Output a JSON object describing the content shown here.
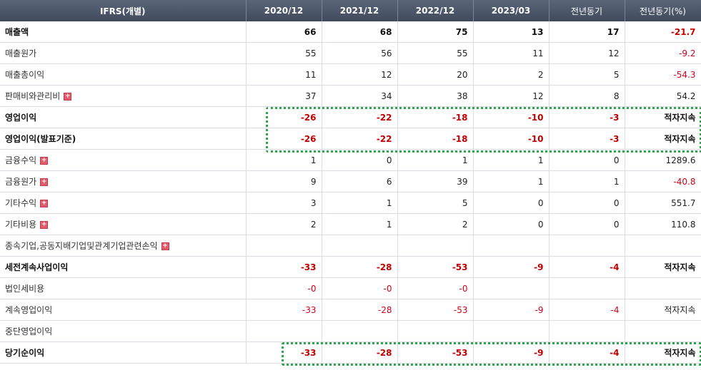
{
  "header": {
    "label": "IFRS(개별)",
    "periods": [
      "2020/12",
      "2021/12",
      "2022/12",
      "2023/03",
      "전년동기",
      "전년동기(%)"
    ]
  },
  "rows": [
    {
      "label": "매출액",
      "values": [
        "66",
        "68",
        "75",
        "13",
        "17",
        "-21.7"
      ],
      "bold": true,
      "expand": false,
      "sep": false
    },
    {
      "label": "매출원가",
      "values": [
        "55",
        "56",
        "55",
        "11",
        "12",
        "-9.2"
      ],
      "bold": false,
      "expand": false,
      "sep": false
    },
    {
      "label": "매출총이익",
      "values": [
        "11",
        "12",
        "20",
        "2",
        "5",
        "-54.3"
      ],
      "bold": false,
      "expand": false,
      "sep": false
    },
    {
      "label": "판매비와관리비",
      "values": [
        "37",
        "34",
        "38",
        "12",
        "8",
        "54.2"
      ],
      "bold": false,
      "expand": true,
      "sep": false
    },
    {
      "label": "영업이익",
      "values": [
        "-26",
        "-22",
        "-18",
        "-10",
        "-3",
        "적자지속"
      ],
      "bold": true,
      "expand": false,
      "sep": true
    },
    {
      "label": "영업이익(발표기준)",
      "values": [
        "-26",
        "-22",
        "-18",
        "-10",
        "-3",
        "적자지속"
      ],
      "bold": true,
      "expand": false,
      "sep": false
    },
    {
      "label": "금융수익",
      "values": [
        "1",
        "0",
        "1",
        "1",
        "0",
        "1289.6"
      ],
      "bold": false,
      "expand": true,
      "sep": false
    },
    {
      "label": "금융원가",
      "values": [
        "9",
        "6",
        "39",
        "1",
        "1",
        "-40.8"
      ],
      "bold": false,
      "expand": true,
      "sep": false
    },
    {
      "label": "기타수익",
      "values": [
        "3",
        "1",
        "5",
        "0",
        "0",
        "551.7"
      ],
      "bold": false,
      "expand": true,
      "sep": false
    },
    {
      "label": "기타비용",
      "values": [
        "2",
        "1",
        "2",
        "0",
        "0",
        "110.8"
      ],
      "bold": false,
      "expand": true,
      "sep": false
    },
    {
      "label": "종속기업,공동지배기업및관계기업관련손익",
      "values": [
        "",
        "",
        "",
        "",
        "",
        ""
      ],
      "bold": false,
      "expand": true,
      "sep": false
    },
    {
      "label": "세전계속사업이익",
      "values": [
        "-33",
        "-28",
        "-53",
        "-9",
        "-4",
        "적자지속"
      ],
      "bold": true,
      "expand": false,
      "sep": true
    },
    {
      "label": "법인세비용",
      "values": [
        "-0",
        "-0",
        "-0",
        "",
        "",
        ""
      ],
      "bold": false,
      "expand": false,
      "sep": false
    },
    {
      "label": "계속영업이익",
      "values": [
        "-33",
        "-28",
        "-53",
        "-9",
        "-4",
        "적자지속"
      ],
      "bold": false,
      "expand": false,
      "sep": false
    },
    {
      "label": "중단영업이익",
      "values": [
        "",
        "",
        "",
        "",
        "",
        ""
      ],
      "bold": false,
      "expand": false,
      "sep": false
    },
    {
      "label": "당기순이익",
      "values": [
        "-33",
        "-28",
        "-53",
        "-9",
        "-4",
        "적자지속"
      ],
      "bold": true,
      "expand": false,
      "sep": true
    }
  ],
  "colors": {
    "header_bg": "#4a5568",
    "negative": "#d0021b",
    "highlight": "#2aa84a",
    "expand_icon": "#e45a6b"
  },
  "icons": {
    "expand": "plus-square-icon"
  }
}
